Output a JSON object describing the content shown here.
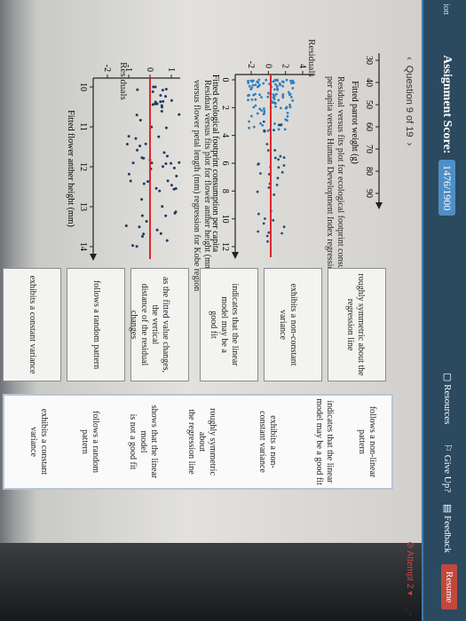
{
  "header": {
    "score_label": "Assignment Score:",
    "score_value": "1476/1900",
    "resources": "Resources",
    "give_up": "Give Up?",
    "feedback": "Feedback",
    "resume": "Resume",
    "attempt": "Attempt 2",
    "left_tab": "ion"
  },
  "question": {
    "label": "Question 9 of 19"
  },
  "plot1": {
    "xlabel": "Fitted parrot weight (g)",
    "x_ticks": [
      "30",
      "40",
      "50",
      "60",
      "70",
      "80",
      "90"
    ]
  },
  "plot2": {
    "caption_line1": "Residual versus fits plot for ecological footprint consumption",
    "caption_line2": "per capita versus Human Development Index regression",
    "ylabel": "Residuals",
    "y_ticks": [
      "4",
      "2",
      "0",
      "-2"
    ],
    "x_ticks": [
      "0",
      "2",
      "4",
      "6",
      "8",
      "10",
      "12"
    ],
    "xlabel": "Fitted ecological footprint consumption per capita"
  },
  "plot3": {
    "caption_line1": "Residual versus fits plot for flower anther height (mm)",
    "caption_line2": "versus flower petal length (mm) regression for Kobe region",
    "ylabel": "Residuals",
    "y_ticks": [
      "1",
      "0",
      "-1",
      "-2"
    ],
    "x_ticks": [
      "10",
      "11",
      "12",
      "13",
      "14"
    ],
    "xlabel": "Fitted flower anther height (mm)"
  },
  "answers": {
    "a1_line1": "roughly symmetric about the",
    "a1_line2": "regression line",
    "a2": "exhibits a non-constant variance",
    "a3_line1": "indicates that the linear model may be a",
    "a3_line2": "good fit",
    "a4_line1": "as the fitted value changes, the vertical",
    "a4_line2": "distance of the residual changes",
    "a5": "follows a random pattern",
    "a6": "exhibits a constant variance"
  },
  "bank": {
    "b1": "follows a non-linear pattern",
    "b2_line1": "indicates that the linear",
    "b2_line2": "model may be a good fit",
    "b3_line1": "exhibits a non-",
    "b3_line2": "constant variance",
    "b4_line1": "roughly symmetric about",
    "b4_line2": "the regression line",
    "b5_line1": "shows that the linear model",
    "b5_line2": "is not a good fit",
    "b6": "follows a random pattern",
    "b7": "exhibits a constant variance"
  },
  "colors": {
    "header": "#2b4a5f",
    "resume": "#c3473a",
    "fit_line": "#e0262b",
    "points_plot2": "#2f7fc0"
  }
}
